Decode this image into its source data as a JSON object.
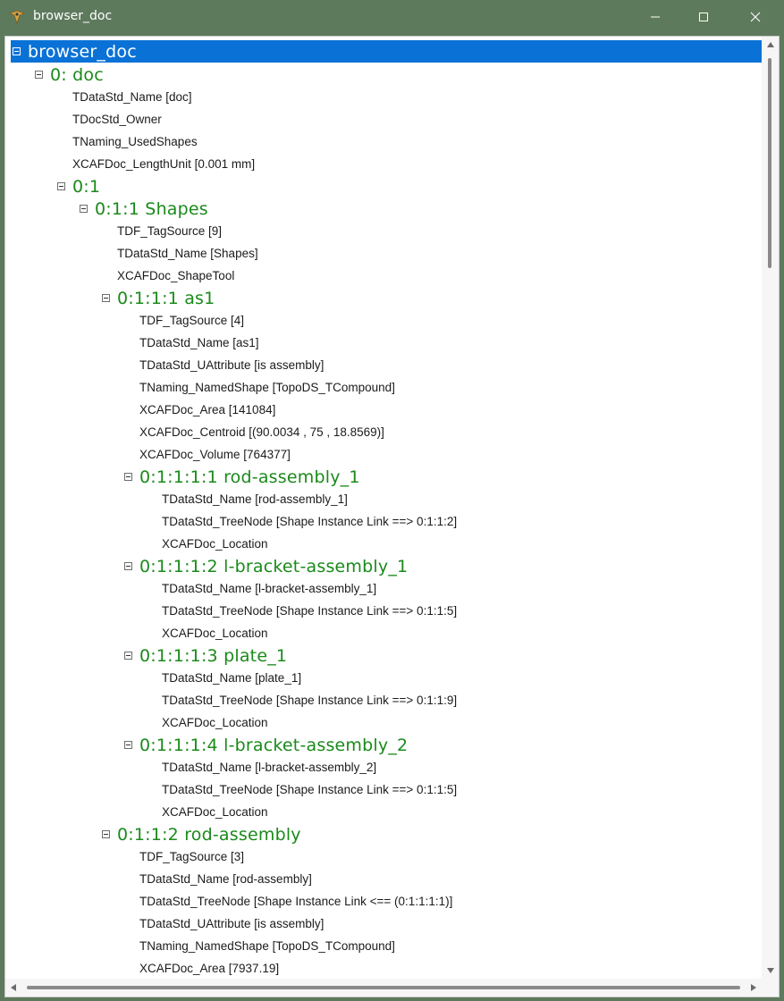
{
  "window": {
    "title": "browser_doc"
  },
  "tree": [
    {
      "kind": "group",
      "depth": 0,
      "label": "browser_doc",
      "selected": true
    },
    {
      "kind": "group",
      "depth": 1,
      "label": "0: doc"
    },
    {
      "kind": "attr",
      "depth": 2,
      "label": "TDataStd_Name [doc]"
    },
    {
      "kind": "attr",
      "depth": 2,
      "label": "TDocStd_Owner"
    },
    {
      "kind": "attr",
      "depth": 2,
      "label": "TNaming_UsedShapes"
    },
    {
      "kind": "attr",
      "depth": 2,
      "label": "XCAFDoc_LengthUnit [0.001 mm]"
    },
    {
      "kind": "group",
      "depth": 2,
      "label": "0:1"
    },
    {
      "kind": "group",
      "depth": 3,
      "label": "0:1:1 Shapes"
    },
    {
      "kind": "attr",
      "depth": 4,
      "label": "TDF_TagSource [9]"
    },
    {
      "kind": "attr",
      "depth": 4,
      "label": "TDataStd_Name [Shapes]"
    },
    {
      "kind": "attr",
      "depth": 4,
      "label": "XCAFDoc_ShapeTool"
    },
    {
      "kind": "group",
      "depth": 4,
      "label": "0:1:1:1 as1"
    },
    {
      "kind": "attr",
      "depth": 5,
      "label": "TDF_TagSource [4]"
    },
    {
      "kind": "attr",
      "depth": 5,
      "label": "TDataStd_Name [as1]"
    },
    {
      "kind": "attr",
      "depth": 5,
      "label": "TDataStd_UAttribute [is assembly]"
    },
    {
      "kind": "attr",
      "depth": 5,
      "label": "TNaming_NamedShape [TopoDS_TCompound]"
    },
    {
      "kind": "attr",
      "depth": 5,
      "label": "XCAFDoc_Area [141084]"
    },
    {
      "kind": "attr",
      "depth": 5,
      "label": "XCAFDoc_Centroid [(90.0034 , 75 , 18.8569)]"
    },
    {
      "kind": "attr",
      "depth": 5,
      "label": "XCAFDoc_Volume [764377]"
    },
    {
      "kind": "group",
      "depth": 5,
      "label": "0:1:1:1:1 rod-assembly_1"
    },
    {
      "kind": "attr",
      "depth": 6,
      "label": "TDataStd_Name [rod-assembly_1]"
    },
    {
      "kind": "attr",
      "depth": 6,
      "label": "TDataStd_TreeNode [Shape Instance Link ==> 0:1:1:2]"
    },
    {
      "kind": "attr",
      "depth": 6,
      "label": "XCAFDoc_Location"
    },
    {
      "kind": "group",
      "depth": 5,
      "label": "0:1:1:1:2 l-bracket-assembly_1"
    },
    {
      "kind": "attr",
      "depth": 6,
      "label": "TDataStd_Name [l-bracket-assembly_1]"
    },
    {
      "kind": "attr",
      "depth": 6,
      "label": "TDataStd_TreeNode [Shape Instance Link ==> 0:1:1:5]"
    },
    {
      "kind": "attr",
      "depth": 6,
      "label": "XCAFDoc_Location"
    },
    {
      "kind": "group",
      "depth": 5,
      "label": "0:1:1:1:3 plate_1"
    },
    {
      "kind": "attr",
      "depth": 6,
      "label": "TDataStd_Name [plate_1]"
    },
    {
      "kind": "attr",
      "depth": 6,
      "label": "TDataStd_TreeNode [Shape Instance Link ==> 0:1:1:9]"
    },
    {
      "kind": "attr",
      "depth": 6,
      "label": "XCAFDoc_Location"
    },
    {
      "kind": "group",
      "depth": 5,
      "label": "0:1:1:1:4 l-bracket-assembly_2"
    },
    {
      "kind": "attr",
      "depth": 6,
      "label": "TDataStd_Name [l-bracket-assembly_2]"
    },
    {
      "kind": "attr",
      "depth": 6,
      "label": "TDataStd_TreeNode [Shape Instance Link ==> 0:1:1:5]"
    },
    {
      "kind": "attr",
      "depth": 6,
      "label": "XCAFDoc_Location"
    },
    {
      "kind": "group",
      "depth": 4,
      "label": "0:1:1:2 rod-assembly"
    },
    {
      "kind": "attr",
      "depth": 5,
      "label": "TDF_TagSource [3]"
    },
    {
      "kind": "attr",
      "depth": 5,
      "label": "TDataStd_Name [rod-assembly]"
    },
    {
      "kind": "attr",
      "depth": 5,
      "label": "TDataStd_TreeNode [Shape Instance Link <== (0:1:1:1:1)]"
    },
    {
      "kind": "attr",
      "depth": 5,
      "label": "TDataStd_UAttribute [is assembly]"
    },
    {
      "kind": "attr",
      "depth": 5,
      "label": "TNaming_NamedShape [TopoDS_TCompound]"
    },
    {
      "kind": "attr",
      "depth": 5,
      "label": "XCAFDoc_Area [7937.19]"
    }
  ]
}
